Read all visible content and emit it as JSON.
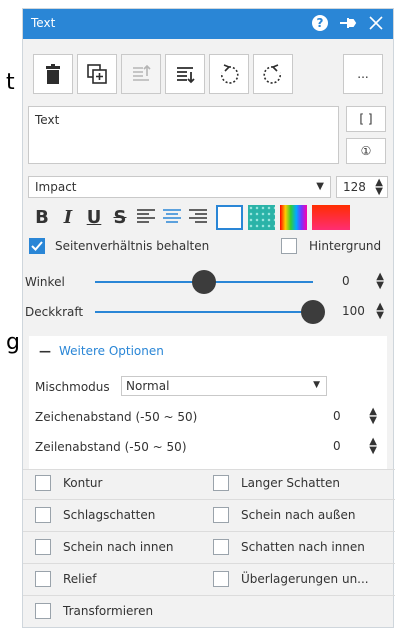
{
  "background": {
    "char_t": "t",
    "char_g": "g"
  },
  "window": {
    "title": "Text"
  },
  "toolbar": {
    "more_label": "..."
  },
  "text_area": {
    "value": "Text"
  },
  "side_buttons": {
    "bracket_label": "[ ]",
    "info_label": "①"
  },
  "font": {
    "family": "Impact",
    "size": "128"
  },
  "swatches": [
    "#ffffff",
    "#2bb3a8",
    "rainbow",
    "#ff3300"
  ],
  "aspect": {
    "label": "Seitenverhältnis behalten",
    "checked": true
  },
  "background_opt": {
    "label": "Hintergrund",
    "checked": false
  },
  "angle": {
    "label": "Winkel",
    "value": "0",
    "fraction": 0.5
  },
  "opacity": {
    "label": "Deckkraft",
    "value": "100",
    "fraction": 1.0
  },
  "more": {
    "toggle": "—",
    "label": "Weitere Optionen"
  },
  "blend": {
    "label": "Mischmodus",
    "value": "Normal"
  },
  "char_spacing": {
    "label": "Zeichenabstand (-50 ~ 50)",
    "value": "0"
  },
  "line_spacing": {
    "label": "Zeilenabstand (-50 ~ 50)",
    "value": "0"
  },
  "effects": [
    {
      "label": "Kontur"
    },
    {
      "label": "Langer Schatten"
    },
    {
      "label": "Schlagschatten"
    },
    {
      "label": "Schein nach außen"
    },
    {
      "label": "Schein nach innen"
    },
    {
      "label": "Schatten nach innen"
    },
    {
      "label": "Relief"
    },
    {
      "label": "Überlagerungen un..."
    },
    {
      "label": "Transformieren"
    }
  ],
  "colors": {
    "accent": "#2a86d6"
  }
}
